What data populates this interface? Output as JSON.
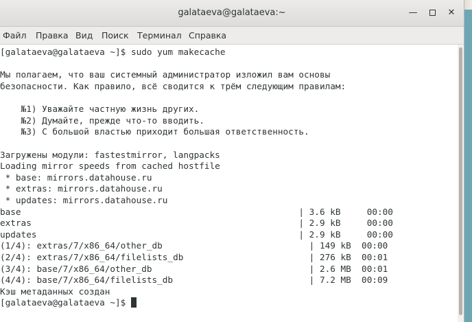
{
  "window": {
    "title": "galataeva@galataeva:~",
    "controls": {
      "minimize_icon": "minimize-icon",
      "maximize_icon": "maximize-icon",
      "close_icon": "close-icon"
    }
  },
  "menu": {
    "items": [
      "Файл",
      "Правка",
      "Вид",
      "Поиск",
      "Терминал",
      "Справка"
    ]
  },
  "terminal": {
    "lines": [
      "[galataeva@galataeva ~]$ sudo yum makecache",
      "",
      "Мы полагаем, что ваш системный администратор изложил вам основы",
      "безопасности. Как правило, всё сводится к трём следующим правилам:",
      "",
      "    №1) Уважайте частную жизнь других.",
      "    №2) Думайте, прежде что-то вводить.",
      "    №3) С большой властью приходит большая ответственность.",
      "",
      "Загружены модули: fastestmirror, langpacks",
      "Loading mirror speeds from cached hostfile",
      " * base: mirrors.datahouse.ru",
      " * extras: mirrors.datahouse.ru",
      " * updates: mirrors.datahouse.ru",
      "base                                                     | 3.6 kB     00:00",
      "extras                                                   | 2.9 kB     00:00",
      "updates                                                  | 2.9 kB     00:00",
      "(1/4): extras/7/x86_64/other_db                            | 149 kB  00:00",
      "(2/4): extras/7/x86_64/filelists_db                        | 276 kB  00:01",
      "(3/4): base/7/x86_64/other_db                              | 2.6 MB  00:01",
      "(4/4): base/7/x86_64/filelists_db                          | 7.2 MB  00:09",
      "Кэш метаданных создан",
      "[galataeva@galataeva ~]$ "
    ]
  }
}
